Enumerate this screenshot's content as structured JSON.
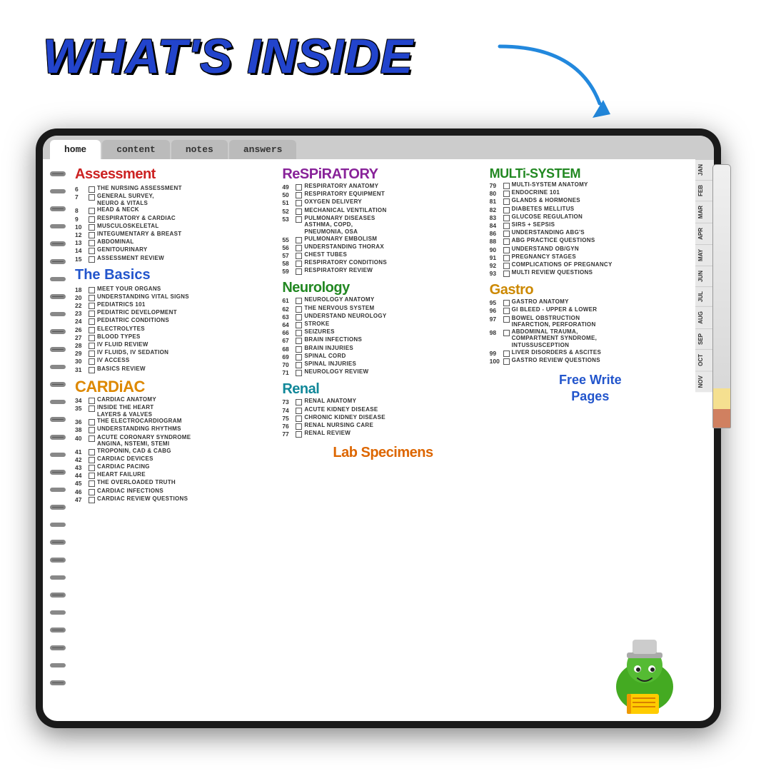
{
  "page": {
    "title": "WHAT'S INSIDE",
    "background_color": "#ffffff"
  },
  "navbar": {
    "tabs": [
      "home",
      "content",
      "notes",
      "answers"
    ],
    "active": "home"
  },
  "sidebar_months": [
    "JAN",
    "FEB",
    "MAR",
    "APR",
    "MAY",
    "JUN",
    "JUL",
    "AUG",
    "SEP",
    "OCT",
    "NOV"
  ],
  "columns": {
    "col1": {
      "sections": [
        {
          "title": "Assessment",
          "color": "red",
          "items": [
            {
              "num": "6",
              "text": "The Nursing Assessment"
            },
            {
              "num": "7",
              "text": "General Survey, Neuro & Vitals"
            },
            {
              "num": "8",
              "text": "Head & Neck"
            },
            {
              "num": "9",
              "text": "Respiratory & Cardiac"
            },
            {
              "num": "10",
              "text": "Musculoskeletal"
            },
            {
              "num": "12",
              "text": "Integumentary & Breast"
            },
            {
              "num": "13",
              "text": "Abdominal"
            },
            {
              "num": "14",
              "text": "Genitourinary"
            },
            {
              "num": "15",
              "text": "Assessment Review"
            }
          ]
        },
        {
          "title": "The Basics",
          "color": "blue",
          "items": [
            {
              "num": "18",
              "text": "Meet Your Organs"
            },
            {
              "num": "20",
              "text": "Understanding Vital Signs"
            },
            {
              "num": "22",
              "text": "Pediatrics 101"
            },
            {
              "num": "23",
              "text": "Pediatric Development"
            },
            {
              "num": "24",
              "text": "Pediatric Conditions"
            },
            {
              "num": "26",
              "text": "Electrolytes"
            },
            {
              "num": "27",
              "text": "Blood Types"
            },
            {
              "num": "28",
              "text": "IV Fluid Review"
            },
            {
              "num": "29",
              "text": "IV Fluids, IV Sedation"
            },
            {
              "num": "30",
              "text": "IV Access"
            },
            {
              "num": "31",
              "text": "Basics Review"
            }
          ]
        },
        {
          "title": "CARDiAC",
          "color": "orange",
          "items": [
            {
              "num": "34",
              "text": "Cardiac Anatomy"
            },
            {
              "num": "35",
              "text": "Inside the Heart Layers & Valves"
            },
            {
              "num": "36",
              "text": "The Electrocardiogram"
            },
            {
              "num": "38",
              "text": "Understanding Rhythms"
            },
            {
              "num": "40",
              "text": "Acute Coronary Syndrome Angina, NSTEMI, STEMI"
            },
            {
              "num": "41",
              "text": "Troponin, CAD & CABG"
            },
            {
              "num": "42",
              "text": "Cardiac Devices"
            },
            {
              "num": "43",
              "text": "Cardiac Pacing"
            },
            {
              "num": "44",
              "text": "Heart Failure"
            },
            {
              "num": "45",
              "text": "The Overloaded Truth"
            },
            {
              "num": "46",
              "text": "Cardiac Infections"
            },
            {
              "num": "47",
              "text": "Cardiac Review Questions"
            }
          ]
        }
      ]
    },
    "col2": {
      "sections": [
        {
          "title": "ReSPiRATORY",
          "color": "purple",
          "items": [
            {
              "num": "49",
              "text": "Respiratory Anatomy"
            },
            {
              "num": "50",
              "text": "Respiratory Equipment"
            },
            {
              "num": "51",
              "text": "Oxygen Delivery"
            },
            {
              "num": "52",
              "text": "Mechanical Ventilation"
            },
            {
              "num": "53",
              "text": "Pulmonary Diseases Asthma, COPD, Pneumonia, OSA"
            },
            {
              "num": "55",
              "text": "Pulmonary Embolism"
            },
            {
              "num": "56",
              "text": "Understanding Thorax"
            },
            {
              "num": "57",
              "text": "Chest Tubes"
            },
            {
              "num": "58",
              "text": "Respiratory Conditions"
            },
            {
              "num": "59",
              "text": "Respiratory Review"
            }
          ]
        },
        {
          "title": "Neurology",
          "color": "green",
          "items": [
            {
              "num": "61",
              "text": "Neurology Anatomy"
            },
            {
              "num": "62",
              "text": "The Nervous System"
            },
            {
              "num": "63",
              "text": "Understand Neurology"
            },
            {
              "num": "64",
              "text": "Stroke"
            },
            {
              "num": "66",
              "text": "Seizures"
            },
            {
              "num": "67",
              "text": "Brain Infections"
            },
            {
              "num": "68",
              "text": "Brain Injuries"
            },
            {
              "num": "69",
              "text": "Spinal Cord"
            },
            {
              "num": "70",
              "text": "Spinal Injuries"
            },
            {
              "num": "71",
              "text": "Neurology Review"
            }
          ]
        },
        {
          "title": "Renal",
          "color": "teal",
          "items": [
            {
              "num": "73",
              "text": "Renal Anatomy"
            },
            {
              "num": "74",
              "text": "Acute Kidney Disease"
            },
            {
              "num": "75",
              "text": "Chronic Kidney Disease"
            },
            {
              "num": "76",
              "text": "Renal Nursing Care"
            },
            {
              "num": "77",
              "text": "Renal Review"
            }
          ]
        },
        {
          "title": "Lab Specimens",
          "color": "orange",
          "items": []
        }
      ]
    },
    "col3": {
      "sections": [
        {
          "title": "MULTi-SYSTEM",
          "color": "green",
          "items": [
            {
              "num": "79",
              "text": "Multi-System Anatomy"
            },
            {
              "num": "80",
              "text": "Endocrine 101"
            },
            {
              "num": "81",
              "text": "Glands & Hormones"
            },
            {
              "num": "82",
              "text": "Diabetes Mellitus"
            },
            {
              "num": "83",
              "text": "Glucose Regulation"
            },
            {
              "num": "84",
              "text": "SIRS + Sepsis"
            },
            {
              "num": "86",
              "text": "Understanding ABG's"
            },
            {
              "num": "88",
              "text": "ABG Practice Questions"
            },
            {
              "num": "90",
              "text": "Understand OB/GYN"
            },
            {
              "num": "91",
              "text": "Pregnancy Stages"
            },
            {
              "num": "92",
              "text": "Complications of Pregnancy"
            },
            {
              "num": "93",
              "text": "Multi Review Questions"
            }
          ]
        },
        {
          "title": "Gastro",
          "color": "gold",
          "items": [
            {
              "num": "95",
              "text": "Gastro Anatomy"
            },
            {
              "num": "96",
              "text": "GI Bleed - Upper & Lower"
            },
            {
              "num": "97",
              "text": "Bowel Obstruction Infarction, Perforation"
            },
            {
              "num": "98",
              "text": "Abdominal Trauma, Compartment Syndrome, Intussusception"
            },
            {
              "num": "99",
              "text": "Liver Disorders & Ascites"
            },
            {
              "num": "100",
              "text": "Gastro Review Questions"
            }
          ]
        },
        {
          "free_write": "Free Write\nPages"
        }
      ]
    }
  }
}
